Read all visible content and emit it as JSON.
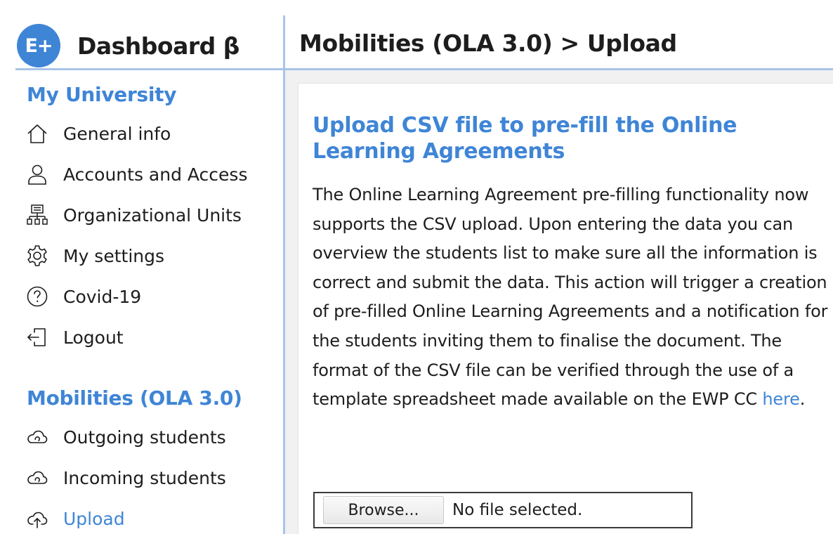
{
  "brand": {
    "logo_text": "E+",
    "title": "Dashboard β"
  },
  "header": {
    "title": "Mobilities (OLA 3.0) > Upload"
  },
  "sidebar": {
    "section_university": {
      "title": "My University",
      "items": [
        {
          "label": "General info",
          "icon": "home-icon"
        },
        {
          "label": "Accounts and Access",
          "icon": "user-icon"
        },
        {
          "label": "Organizational Units",
          "icon": "org-chart-icon"
        },
        {
          "label": "My settings",
          "icon": "gear-icon"
        },
        {
          "label": "Covid-19",
          "icon": "question-circle-icon"
        },
        {
          "label": "Logout",
          "icon": "logout-icon"
        }
      ]
    },
    "section_mobilities": {
      "title": "Mobilities (OLA 3.0)",
      "items": [
        {
          "label": "Outgoing students",
          "icon": "cloud-icon"
        },
        {
          "label": "Incoming students",
          "icon": "cloud-icon"
        },
        {
          "label": "Upload",
          "icon": "cloud-upload-icon",
          "active": true
        }
      ]
    }
  },
  "main": {
    "title": "Upload CSV file to pre-fill the Online Learning Agreements",
    "description": "The Online Learning Agreement pre-filling functionality now supports the CSV upload. Upon entering the data you can overview the students list to make sure all the information is correct and submit the data. This action will trigger a creation of pre-filled Online Learning Agreements and a notification for the students inviting them to finalise the document. The format of the CSV file can be verified through the use of a template spreadsheet made available on the EWP CC ",
    "link_text": "here",
    "description_end": ".",
    "file_input": {
      "button_label": "Browse...",
      "status": "No file selected."
    }
  },
  "colors": {
    "accent": "#3f85d6",
    "divider": "#a8c4e8",
    "text": "#1d1d1d"
  }
}
